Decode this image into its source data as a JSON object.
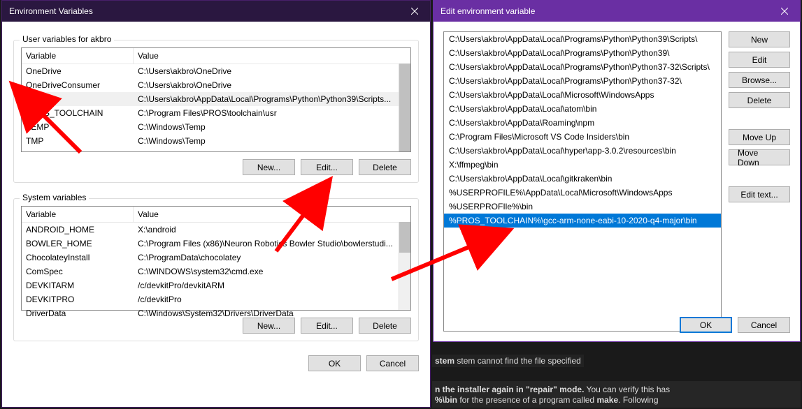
{
  "win1": {
    "title": "Environment Variables",
    "user_label": "User variables for akbro",
    "system_label": "System variables",
    "headers": {
      "variable": "Variable",
      "value": "Value"
    },
    "user_vars": [
      {
        "name": "OneDrive",
        "value": "C:\\Users\\akbro\\OneDrive"
      },
      {
        "name": "OneDriveConsumer",
        "value": "C:\\Users\\akbro\\OneDrive"
      },
      {
        "name": "Path",
        "value": "C:\\Users\\akbro\\AppData\\Local\\Programs\\Python\\Python39\\Scripts..."
      },
      {
        "name": "PROS_TOOLCHAIN",
        "value": "C:\\Program Files\\PROS\\toolchain\\usr"
      },
      {
        "name": "TEMP",
        "value": "C:\\Windows\\Temp"
      },
      {
        "name": "TMP",
        "value": "C:\\Windows\\Temp"
      }
    ],
    "system_vars": [
      {
        "name": "ANDROID_HOME",
        "value": "X:\\android"
      },
      {
        "name": "BOWLER_HOME",
        "value": "C:\\Program Files (x86)\\Neuron Robotics Bowler Studio\\bowlerstudi..."
      },
      {
        "name": "ChocolateyInstall",
        "value": "C:\\ProgramData\\chocolatey"
      },
      {
        "name": "ComSpec",
        "value": "C:\\WINDOWS\\system32\\cmd.exe"
      },
      {
        "name": "DEVKITARM",
        "value": "/c/devkitPro/devkitARM"
      },
      {
        "name": "DEVKITPRO",
        "value": "/c/devkitPro"
      },
      {
        "name": "DriverData",
        "value": "C:\\Windows\\System32\\Drivers\\DriverData"
      }
    ],
    "btn_new": "New...",
    "btn_edit": "Edit...",
    "btn_delete": "Delete",
    "btn_ok": "OK",
    "btn_cancel": "Cancel"
  },
  "win2": {
    "title": "Edit environment variable",
    "paths": [
      "C:\\Users\\akbro\\AppData\\Local\\Programs\\Python\\Python39\\Scripts\\",
      "C:\\Users\\akbro\\AppData\\Local\\Programs\\Python\\Python39\\",
      "C:\\Users\\akbro\\AppData\\Local\\Programs\\Python\\Python37-32\\Scripts\\",
      "C:\\Users\\akbro\\AppData\\Local\\Programs\\Python\\Python37-32\\",
      "C:\\Users\\akbro\\AppData\\Local\\Microsoft\\WindowsApps",
      "C:\\Users\\akbro\\AppData\\Local\\atom\\bin",
      "C:\\Users\\akbro\\AppData\\Roaming\\npm",
      "C:\\Program Files\\Microsoft VS Code Insiders\\bin",
      "C:\\Users\\akbro\\AppData\\Local\\hyper\\app-3.0.2\\resources\\bin",
      "X:\\ffmpeg\\bin",
      "C:\\Users\\akbro\\AppData\\Local\\gitkraken\\bin",
      "%USERPROFILE%\\AppData\\Local\\Microsoft\\WindowsApps",
      "%USERPROFIle%\\bin",
      "%PROS_TOOLCHAIN%\\gcc-arm-none-eabi-10-2020-q4-major\\bin"
    ],
    "selected_index": 13,
    "btn_new": "New",
    "btn_edit": "Edit",
    "btn_browse": "Browse...",
    "btn_delete": "Delete",
    "btn_moveup": "Move Up",
    "btn_movedown": "Move Down",
    "btn_edittext": "Edit text...",
    "btn_ok": "OK",
    "btn_cancel": "Cancel"
  },
  "bg": {
    "line1": "stem cannot find the file specified",
    "line2_a": "n the installer again in \"repair\" mode.",
    "line2_b": " You can verify this has",
    "line3_a": "%\\bin",
    "line3_b": " for the presence of a program called ",
    "line3_c": "make",
    "line3_d": ". Following"
  }
}
